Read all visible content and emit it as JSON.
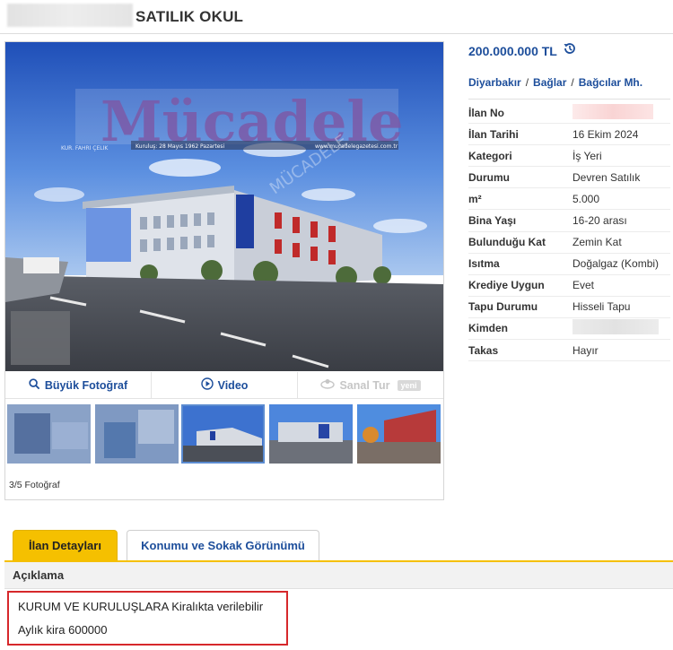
{
  "header": {
    "title": "SATILIK OKUL"
  },
  "photo": {
    "logo_text": "Mücadele",
    "logo_subline": "Kuruluş: 28 Mayıs 1962 Pazartesi",
    "logo_url": "www.mucadelegazetesi.com.tr",
    "logo_side": "KUR. FAHRİ ÇELİK",
    "logo_badge": "MÜCADELE"
  },
  "media": {
    "big_photo": "Büyük Fotoğraf",
    "video": "Video",
    "virtual_tour": "Sanal Tur",
    "new_badge": "yeni"
  },
  "gallery": {
    "counter": "3/5 Fotoğraf"
  },
  "listing": {
    "price": "200.000.000 TL",
    "location": [
      "Diyarbakır",
      "Bağlar",
      "Bağcılar Mh."
    ],
    "details": [
      {
        "label": "İlan No",
        "value": ""
      },
      {
        "label": "İlan Tarihi",
        "value": "16 Ekim 2024"
      },
      {
        "label": "Kategori",
        "value": "İş Yeri"
      },
      {
        "label": "Durumu",
        "value": "Devren Satılık"
      },
      {
        "label": "m²",
        "value": "5.000"
      },
      {
        "label": "Bina Yaşı",
        "value": "16-20 arası"
      },
      {
        "label": "Bulunduğu Kat",
        "value": "Zemin Kat"
      },
      {
        "label": "Isıtma",
        "value": "Doğalgaz (Kombi)"
      },
      {
        "label": "Krediye Uygun",
        "value": "Evet"
      },
      {
        "label": "Tapu Durumu",
        "value": "Hisseli Tapu"
      },
      {
        "label": "Kimden",
        "value": ""
      },
      {
        "label": "Takas",
        "value": "Hayır"
      }
    ]
  },
  "tabs": [
    {
      "label": "İlan Detayları"
    },
    {
      "label": "Konumu ve Sokak Görünümü"
    }
  ],
  "description": {
    "heading": "Açıklama",
    "lines": [
      "KURUM VE KURULUŞLARA Kiralıkta verilebilir",
      "Aylık kira 600000"
    ]
  },
  "colors": {
    "accent": "#1d4e9b",
    "tab_active": "#f5c000",
    "highlight_border": "#d6282b"
  }
}
